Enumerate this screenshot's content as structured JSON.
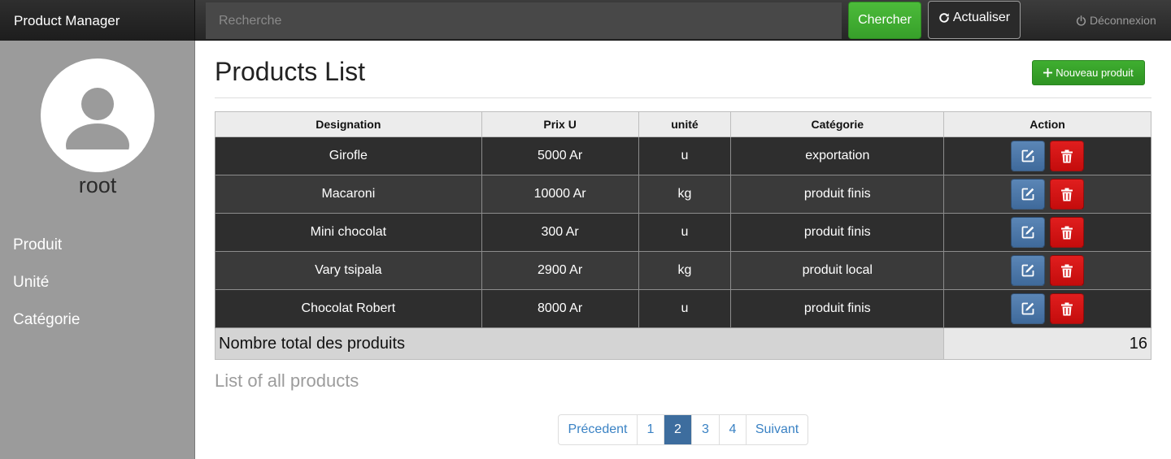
{
  "navbar": {
    "brand": "Product Manager",
    "search_placeholder": "Recherche",
    "search_button": "Chercher",
    "refresh_button": "Actualiser",
    "logout": "Déconnexion"
  },
  "sidebar": {
    "username": "root",
    "items": [
      {
        "label": "Produit"
      },
      {
        "label": "Unité"
      },
      {
        "label": "Catégorie"
      }
    ]
  },
  "main": {
    "title": "Products List",
    "new_button": "Nouveau produit",
    "table": {
      "headers": [
        "Designation",
        "Prix U",
        "unité",
        "Catégorie",
        "Action"
      ],
      "rows": [
        {
          "designation": "Girofle",
          "prix": "5000 Ar",
          "unite": "u",
          "categorie": "exportation"
        },
        {
          "designation": "Macaroni",
          "prix": "10000 Ar",
          "unite": "kg",
          "categorie": "produit finis"
        },
        {
          "designation": "Mini chocolat",
          "prix": "300 Ar",
          "unite": "u",
          "categorie": "produit finis"
        },
        {
          "designation": "Vary tsipala",
          "prix": "2900 Ar",
          "unite": "kg",
          "categorie": "produit local"
        },
        {
          "designation": "Chocolat Robert",
          "prix": "8000 Ar",
          "unite": "u",
          "categorie": "produit finis"
        }
      ],
      "total_label": "Nombre total des produits",
      "total_value": "16"
    },
    "caption": "List of all products",
    "pagination": {
      "prev": "Précedent",
      "pages": [
        "1",
        "2",
        "3",
        "4"
      ],
      "active": "2",
      "next": "Suivant"
    }
  },
  "colors": {
    "accent_green": "#3fae30",
    "edit_blue": "#4a77a8",
    "delete_red": "#d41414",
    "pagination_active": "#3d6d9e"
  },
  "icons": {
    "refresh": "refresh-icon",
    "logout": "power-icon",
    "new": "plus-icon",
    "edit": "edit-icon",
    "delete": "trash-icon",
    "avatar": "user-avatar-icon"
  }
}
